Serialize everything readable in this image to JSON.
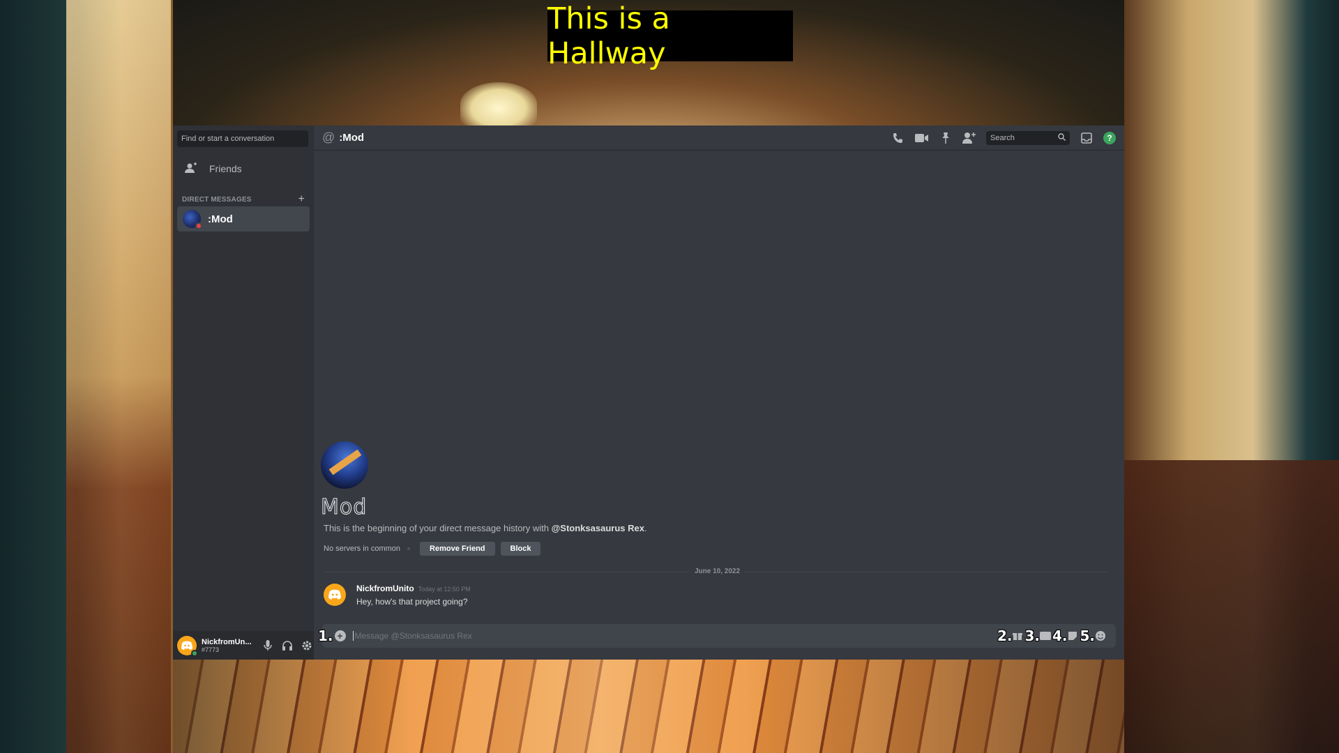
{
  "caption": {
    "text": "This is a Hallway"
  },
  "sidebar": {
    "search_placeholder": "Find or start a conversation",
    "friends_label": "Friends",
    "dm_header": "DIRECT MESSAGES",
    "dm_add": "+",
    "dm_items": [
      {
        "name": ":Mod"
      }
    ]
  },
  "userbar": {
    "name": "NickfromUn...",
    "tag": "#7773"
  },
  "topbar": {
    "channel_name": ":Mod",
    "search_label": "Search",
    "help": "?"
  },
  "welcome": {
    "name": "Mod",
    "desc_prefix": "This is the beginning of your direct message history with ",
    "desc_user": "@Stonksasaurus Rex",
    "desc_suffix": ".",
    "no_servers": "No servers in common",
    "remove_friend": "Remove Friend",
    "block": "Block"
  },
  "divider_date": "June 10, 2022",
  "message": {
    "author": "NickfromUnito",
    "time": "Today at 12:50 PM",
    "text": "Hey, how's that project going?"
  },
  "composer": {
    "placeholder": "Message @Stonksasaurus Rex",
    "labels": [
      "1.",
      "2.",
      "3.",
      "4.",
      "5."
    ]
  },
  "colors": {
    "background": "#36393f",
    "sidebar": "#2f3136",
    "accent_green": "#3ba55d",
    "avatar_orange": "#faa61a",
    "caption_text": "#ffff00"
  }
}
